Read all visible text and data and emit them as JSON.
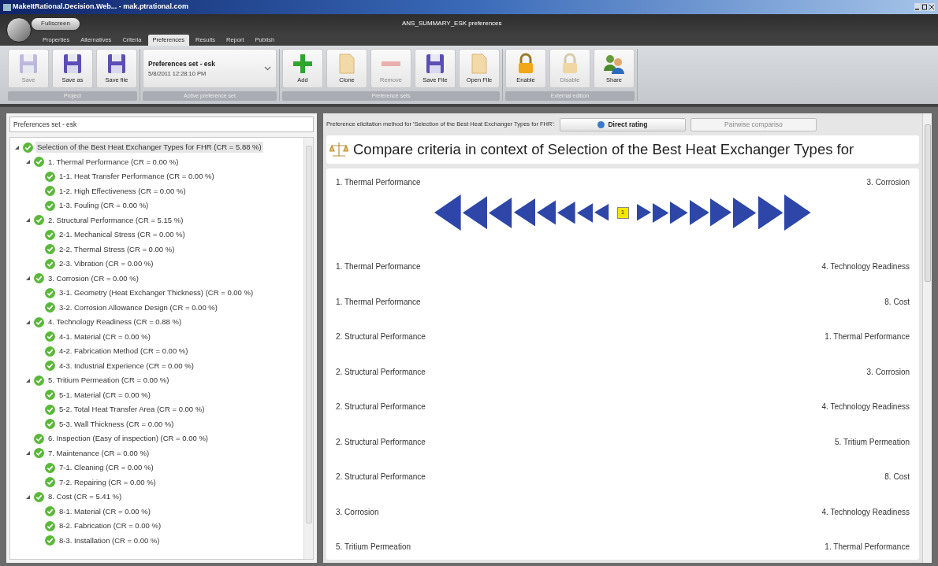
{
  "window": {
    "title": "MakeItRational.Decision.Web... - mak.ptrational.com"
  },
  "app": {
    "fullscreen_label": "Fullscreen",
    "document_title": "ANS_SUMMARY_ESK preferences"
  },
  "tabs": [
    {
      "label": "Properties",
      "selected": false
    },
    {
      "label": "Alternatives",
      "selected": false
    },
    {
      "label": "Criteria",
      "selected": false
    },
    {
      "label": "Preferences",
      "selected": true
    },
    {
      "label": "Results",
      "selected": false
    },
    {
      "label": "Report",
      "selected": false
    },
    {
      "label": "Publish",
      "selected": false
    }
  ],
  "ribbon": [
    {
      "kind": "buttons",
      "title": "Project",
      "items": [
        {
          "label": "Save",
          "kind": "floppy",
          "disabled": true
        },
        {
          "label": "Save as",
          "kind": "floppy",
          "disabled": false
        },
        {
          "label": "Save file",
          "kind": "floppy",
          "disabled": false
        }
      ]
    },
    {
      "kind": "dropdown",
      "title": "Active preference set",
      "name": "Preferences set - esk",
      "date": "5/8/2011 12:28:10 PM"
    },
    {
      "kind": "buttons",
      "title": "Preference sets",
      "items": [
        {
          "label": "Add",
          "kind": "plus",
          "disabled": false
        },
        {
          "label": "Clone",
          "kind": "page",
          "disabled": false
        },
        {
          "label": "Remove",
          "kind": "minus",
          "disabled": true
        },
        {
          "label": "Save File",
          "kind": "floppy",
          "disabled": false
        },
        {
          "label": "Open File",
          "kind": "page",
          "disabled": false
        }
      ]
    },
    {
      "kind": "buttons",
      "title": "External edition",
      "items": [
        {
          "label": "Enable",
          "kind": "lock",
          "disabled": false
        },
        {
          "label": "Disable",
          "kind": "lock",
          "disabled": true
        },
        {
          "label": "Share",
          "kind": "users",
          "disabled": false
        }
      ]
    }
  ],
  "left_panel": {
    "header": "Preferences set - esk",
    "tree": [
      {
        "label": "Selection of the Best Heat Exchanger Types for FHR (CR = 5.88 %)",
        "selected": true,
        "expanded": true,
        "children": [
          {
            "label": "1. Thermal Performance (CR = 0.00 %)",
            "selected": false,
            "expanded": true,
            "children": [
              {
                "label": "1-1. Heat Transfer Performance (CR = 0.00 %)",
                "selected": false
              },
              {
                "label": "1-2. High Effectiveness (CR = 0.00 %)",
                "selected": false
              },
              {
                "label": "1-3. Fouling (CR = 0.00 %)",
                "selected": false
              }
            ]
          },
          {
            "label": "2. Structural Performance (CR = 5.15 %)",
            "selected": false,
            "expanded": true,
            "children": [
              {
                "label": "2-1. Mechanical Stress (CR = 0.00 %)",
                "selected": false
              },
              {
                "label": "2-2. Thermal Stress (CR = 0.00 %)",
                "selected": false
              },
              {
                "label": "2-3. Vibration (CR = 0.00 %)",
                "selected": false
              }
            ]
          },
          {
            "label": "3. Corrosion (CR = 0.00 %)",
            "selected": false,
            "expanded": true,
            "children": [
              {
                "label": "3-1. Geometry (Heat Exchanger Thickness) (CR = 0.00 %)",
                "selected": false
              },
              {
                "label": "3-2. Corrosion Allowance Design (CR = 0.00 %)",
                "selected": false
              }
            ]
          },
          {
            "label": "4. Technology Readiness (CR = 0.88 %)",
            "selected": false,
            "expanded": true,
            "children": [
              {
                "label": "4-1. Material (CR = 0.00 %)",
                "selected": false
              },
              {
                "label": "4-2. Fabrication Method (CR = 0.00 %)",
                "selected": false
              },
              {
                "label": "4-3. Industrial Experience (CR = 0.00 %)",
                "selected": false
              }
            ]
          },
          {
            "label": "5. Tritium Permeation (CR = 0.00 %)",
            "selected": false,
            "expanded": true,
            "children": [
              {
                "label": "5-1. Material (CR = 0.00 %)",
                "selected": false
              },
              {
                "label": "5-2. Total Heat Transfer Area (CR = 0.00 %)",
                "selected": false
              },
              {
                "label": "5-3. Wall Thickness (CR = 0.00 %)",
                "selected": false
              }
            ]
          },
          {
            "label": "6. Inspection (Easy of inspection) (CR = 0.00 %)",
            "selected": false
          },
          {
            "label": "7. Maintenance (CR = 0.00 %)",
            "selected": false,
            "expanded": true,
            "children": [
              {
                "label": "7-1. Cleaning (CR = 0.00 %)",
                "selected": false
              },
              {
                "label": "7-2. Repairing (CR = 0.00 %)",
                "selected": false
              }
            ]
          },
          {
            "label": "8. Cost (CR = 5.41 %)",
            "selected": false,
            "expanded": true,
            "children": [
              {
                "label": "8-1. Material (CR = 0.00 %)",
                "selected": false
              },
              {
                "label": "8-2. Fabrication (CR = 0.00 %)",
                "selected": false
              },
              {
                "label": "8-3. Installation (CR = 0.00 %)",
                "selected": false
              }
            ]
          }
        ]
      }
    ]
  },
  "right_panel": {
    "method_label": "Preference elicitation method for 'Selection of the Best Heat Exchanger Types for FHR':",
    "methods": [
      {
        "label": "Direct rating",
        "selected": true,
        "disabled": false
      },
      {
        "label": "Pairwise compariso",
        "selected": false,
        "disabled": true
      }
    ],
    "heading": "Compare criteria in context of Selection of the Best Heat Exchanger Types for",
    "comparisons": [
      {
        "left": "1. Thermal Performance",
        "right": "3. Corrosion",
        "scale": [
          {
            "selected": false
          },
          {
            "selected": false
          },
          {
            "selected": false
          },
          {
            "selected": false
          },
          {
            "selected": false
          },
          {
            "selected": false
          },
          {
            "selected": false
          },
          {
            "selected": false
          },
          {
            "selected": true,
            "label": "1"
          },
          {
            "selected": false
          },
          {
            "selected": false
          },
          {
            "selected": false
          },
          {
            "selected": false
          },
          {
            "selected": false
          },
          {
            "selected": false
          },
          {
            "selected": false
          },
          {
            "selected": false
          }
        ]
      },
      {
        "left": "1. Thermal Performance",
        "right": "4. Technology Readiness"
      },
      {
        "left": "1. Thermal Performance",
        "right": "8. Cost"
      },
      {
        "left": "2. Structural Performance",
        "right": "1. Thermal Performance"
      },
      {
        "left": "2. Structural Performance",
        "right": "3. Corrosion"
      },
      {
        "left": "2. Structural Performance",
        "right": "4. Technology Readiness"
      },
      {
        "left": "2. Structural Performance",
        "right": "5. Tritium Permeation"
      },
      {
        "left": "2. Structural Performance",
        "right": "8. Cost"
      },
      {
        "left": "3. Corrosion",
        "right": "4. Technology Readiness"
      },
      {
        "left": "5. Tritium Permeation",
        "right": "1. Thermal Performance"
      }
    ]
  }
}
